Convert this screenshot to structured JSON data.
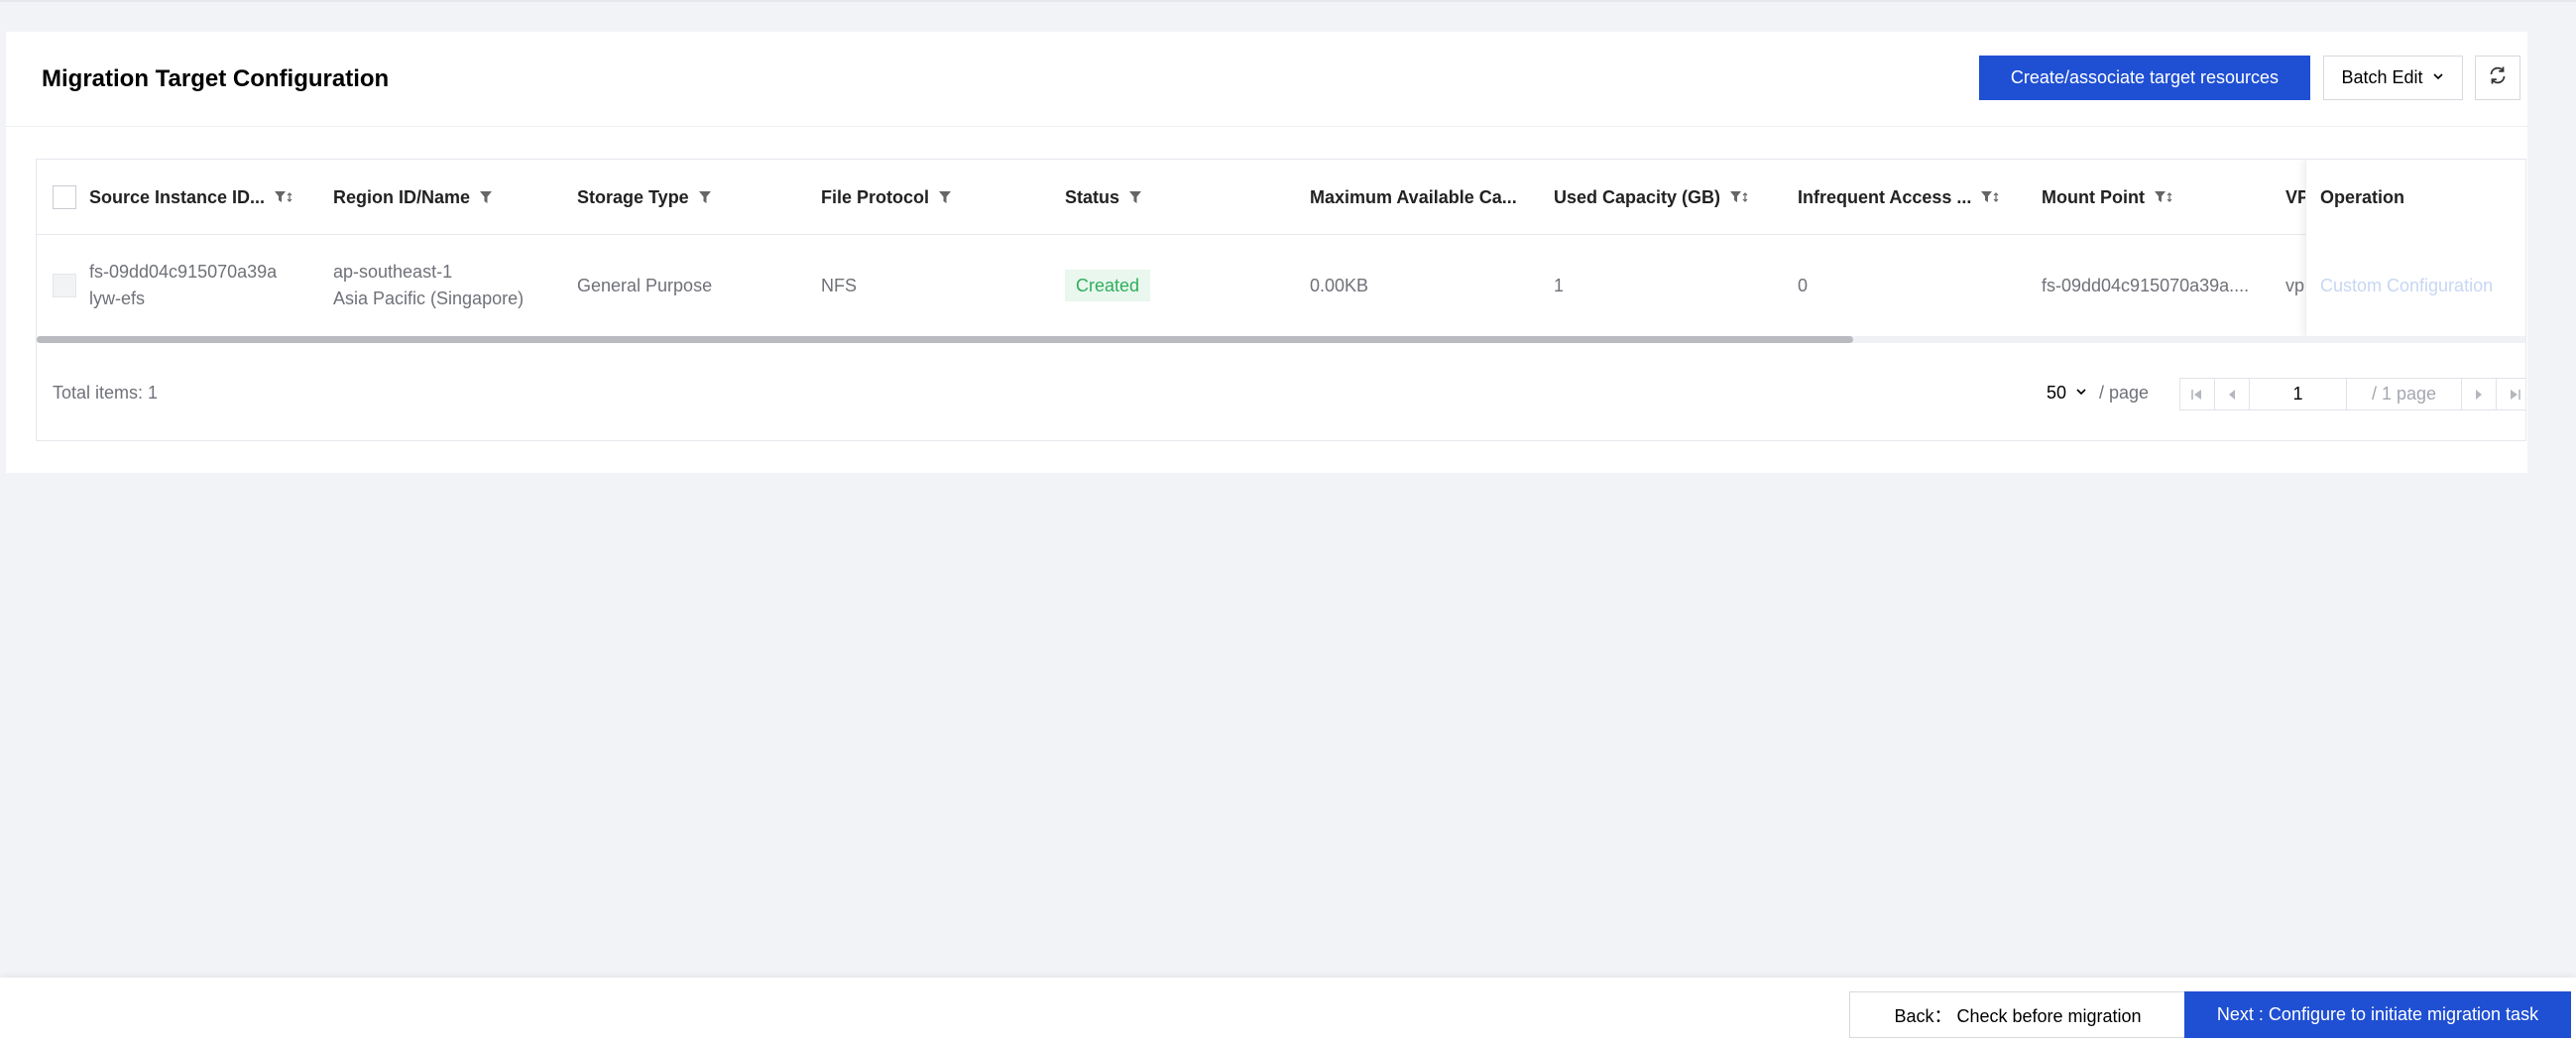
{
  "panel": {
    "title": "Migration Target Configuration",
    "create_button": "Create/associate target resources",
    "batch_edit_button": "Batch Edit"
  },
  "table": {
    "columns": [
      "Source Instance ID...",
      "Region ID/Name",
      "Storage Type",
      "File Protocol",
      "Status",
      "Maximum Available Ca...",
      "Used Capacity (GB)",
      "Infrequent Access ...",
      "Mount Point",
      "VP",
      "Operation"
    ],
    "rows": [
      {
        "instance_id": "fs-09dd04c915070a39a",
        "instance_name": "lyw-efs",
        "region_id": "ap-southeast-1",
        "region_name": "Asia Pacific (Singapore)",
        "storage_type": "General Purpose",
        "file_protocol": "NFS",
        "status": "Created",
        "max_capacity": "0.00KB",
        "used_capacity": "1",
        "infrequent_access": "0",
        "mount_point": "fs-09dd04c915070a39a....",
        "vpc": "vp",
        "operation": "Custom Configuration"
      }
    ],
    "scroll_fraction": 0.73
  },
  "pagination": {
    "total": "Total items: 1",
    "page_size": "50",
    "per_page": "/ page",
    "current_page": "1",
    "total_pages": "/ 1 page"
  },
  "footer": {
    "back_button": "Back： Check before migration",
    "next_button": "Next : Configure to initiate migration task"
  },
  "colors": {
    "primary": "#1f4fd3",
    "status_green": "#2fae5b",
    "background": "#f2f3f7"
  }
}
